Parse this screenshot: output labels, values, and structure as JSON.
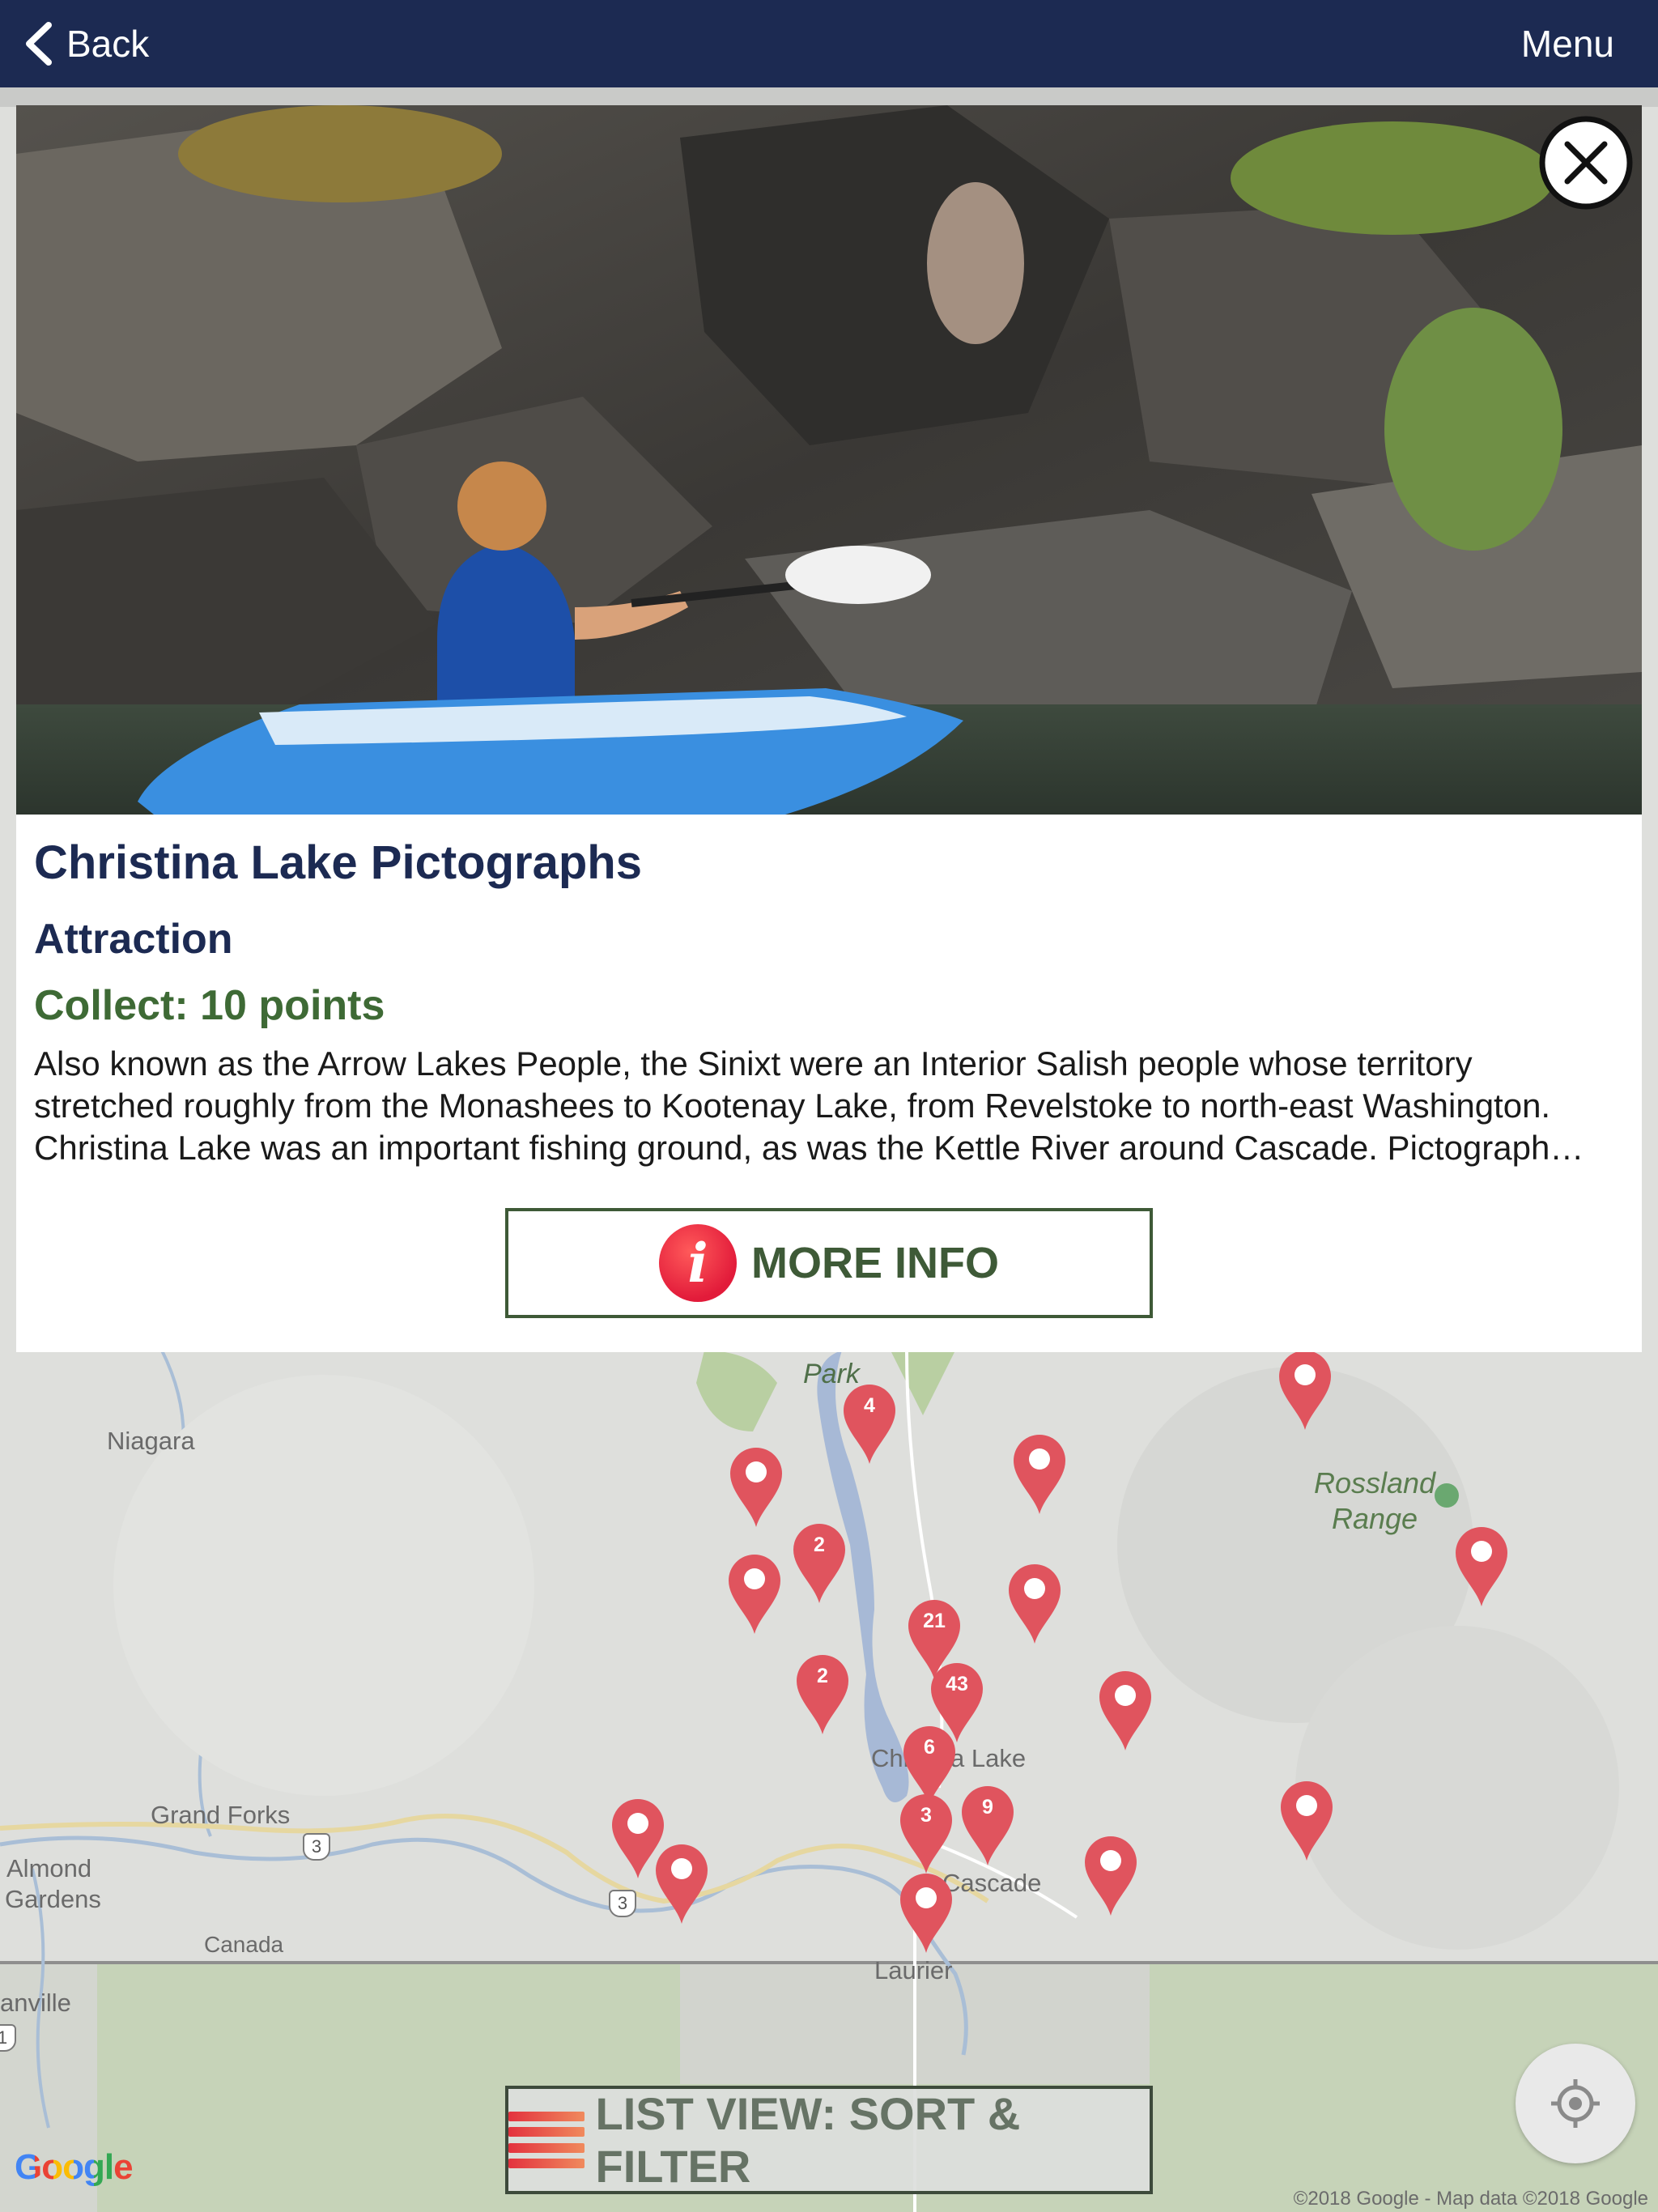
{
  "navbar": {
    "back_label": "Back",
    "menu_label": "Menu"
  },
  "popup": {
    "title": "Christina Lake Pictographs",
    "category": "Attraction",
    "points": "Collect: 10 points",
    "description_lines": [
      "Also known as the Arrow Lakes People, the Sinixt were an Interior Salish people whose territory",
      "stretched roughly from the Monashees to Kootenay Lake, from Revelstoke to north-east Washington.",
      "Christina Lake was an important fishing ground, as was the Kettle River around Cascade. Pictograph…"
    ],
    "more_info_label": "MORE INFO",
    "info_icon_glyph": "i"
  },
  "map": {
    "labels": {
      "park": "Park",
      "niagara": "Niagara",
      "rossland_range": "Rossland Range",
      "grand_forks": "Grand Forks",
      "almond_gardens_1": "Almond",
      "almond_gardens_2": "Gardens",
      "canada": "Canada",
      "christina_lake_a": "Chr",
      "christina_lake_b": "a Lake",
      "cascade": "Cascade",
      "laurier": "Laurier",
      "danville": "anville",
      "hwy_3a": "3",
      "hwy_3b": "3",
      "hwy_edge": "1"
    },
    "cluster_counts": [
      "4",
      "2",
      "21",
      "43",
      "2",
      "6",
      "9",
      "3"
    ],
    "google_logo": "Google",
    "copyright": "©2018 Google - Map data ©2018 Google",
    "pin_color": "#e0545e"
  },
  "list_button_label": "LIST VIEW: SORT & FILTER"
}
